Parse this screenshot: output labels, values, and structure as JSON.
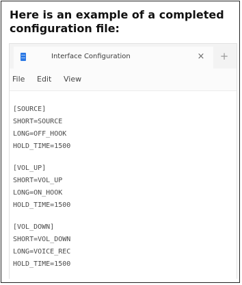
{
  "caption": "Here is an example of a completed configuration file:",
  "window": {
    "tab_title": "Interface Configuration",
    "tab_close_glyph": "×",
    "tab_add_glyph": "+",
    "app_icon": "notepad-icon"
  },
  "menu": {
    "file": "File",
    "edit": "Edit",
    "view": "View"
  },
  "editor": {
    "lines": [
      "[SOURCE]",
      "SHORT=SOURCE",
      "LONG=OFF_HOOK",
      "HOLD_TIME=1500",
      "",
      "[VOL_UP]",
      "SHORT=VOL_UP",
      "LONG=ON_HOOK",
      "HOLD_TIME=1500",
      "",
      "[VOL_DOWN]",
      "SHORT=VOL_DOWN",
      "LONG=VOICE_REC",
      "HOLD_TIME=1500"
    ]
  }
}
